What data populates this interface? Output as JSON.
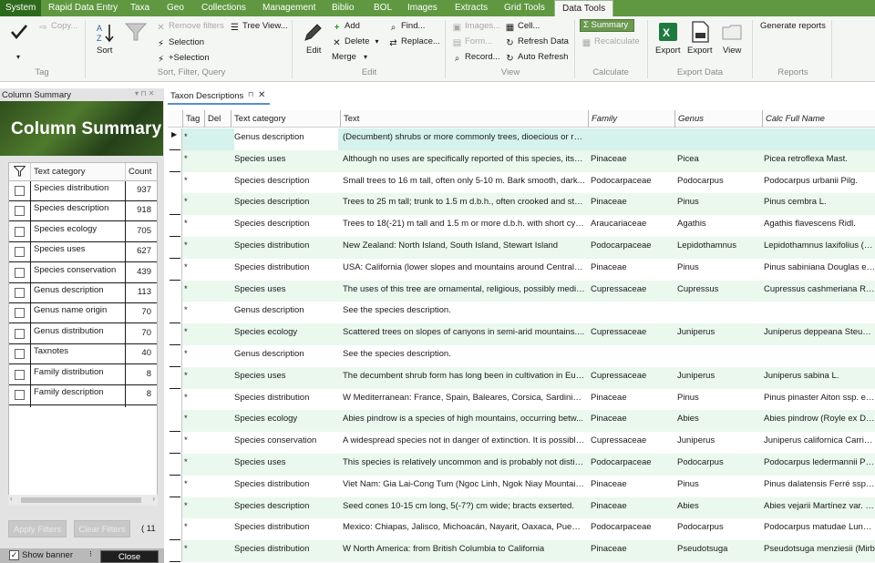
{
  "menu": {
    "system": "System",
    "tabs": [
      "Rapid Data Entry",
      "Taxa",
      "Geo",
      "Collections",
      "Management",
      "Biblio",
      "BOL",
      "Images",
      "Extracts",
      "Grid Tools"
    ],
    "active": "Data Tools"
  },
  "ribbon": {
    "tag_group": {
      "copy": "Copy...",
      "label": "Tag"
    },
    "sort_group": {
      "sort": "Sort",
      "remove_filters": "Remove filters",
      "tree_view": "Tree View...",
      "selection": "Selection",
      "plus_selection": "+Selection",
      "label": "Sort, Filter, Query"
    },
    "edit_group": {
      "edit": "Edit",
      "add": "Add",
      "delete": "Delete",
      "merge": "Merge",
      "find": "Find...",
      "replace": "Replace...",
      "label": "Edit"
    },
    "view_group": {
      "images": "Images...",
      "form": "Form...",
      "record": "Record...",
      "cell": "Cell...",
      "refresh_data": "Refresh Data",
      "auto_refresh": "Auto Refresh",
      "label": "View"
    },
    "calc_group": {
      "summary": "Summary",
      "recalculate": "Recalculate",
      "label": "Calculate"
    },
    "export_group": {
      "export": "Export",
      "export2": "Export",
      "view": "View",
      "label": "Export Data"
    },
    "reports_group": {
      "generate": "Generate reports",
      "label": "Reports"
    }
  },
  "column_summary": {
    "panel_title": "Column Summary",
    "banner": "Column Summary",
    "col_category": "Text category",
    "col_count": "Count",
    "rows": [
      {
        "cat": "Species distribution",
        "count": "937"
      },
      {
        "cat": "Species description",
        "count": "918"
      },
      {
        "cat": "Species ecology",
        "count": "705"
      },
      {
        "cat": "Species uses",
        "count": "627"
      },
      {
        "cat": "Species conservation",
        "count": "439"
      },
      {
        "cat": "Genus description",
        "count": "113"
      },
      {
        "cat": "Genus name origin",
        "count": "70"
      },
      {
        "cat": "Genus distribution",
        "count": "70"
      },
      {
        "cat": "Taxnotes",
        "count": "40"
      },
      {
        "cat": "Family distribution",
        "count": "8"
      },
      {
        "cat": "Family description",
        "count": "8"
      }
    ],
    "apply_filters": "Apply Filters",
    "clear_filters": "Clear Filters",
    "count_label": "( 11",
    "show_banner": "Show banner",
    "close": "Close"
  },
  "doc_tab": {
    "title": "Taxon Descriptions"
  },
  "grid": {
    "columns": [
      "Tag",
      "Del",
      "Text category",
      "Text",
      "Family",
      "Genus",
      "Calc Full Name"
    ],
    "rows": [
      {
        "tag": "*",
        "cat": "Genus description",
        "text": "(Decumbent) shrubs or more commonly trees, dioecious or ra...",
        "family": "",
        "genus": "",
        "name": ""
      },
      {
        "tag": "*",
        "cat": "Species uses",
        "text": "Although no uses are specifically reported of this species, its ti...",
        "family": "Pinaceae",
        "genus": "Picea",
        "name": "Picea retroflexa Mast."
      },
      {
        "tag": "*",
        "cat": "Species description",
        "text": "Small trees to 16 m tall, often only 5-10 m. Bark smooth, dark...",
        "family": "Podocarpaceae",
        "genus": "Podocarpus",
        "name": "Podocarpus urbanii Pilg."
      },
      {
        "tag": "*",
        "cat": "Species description",
        "text": "Trees to 25 m tall; trunk to 1.5 m d.b.h., often crooked and stu...",
        "family": "Pinaceae",
        "genus": "Pinus",
        "name": "Pinus cembra L."
      },
      {
        "tag": "*",
        "cat": "Species description",
        "text": "Trees to 18(-21) m tall and 1.5 m or more d.b.h. with short cyli...",
        "family": "Araucariaceae",
        "genus": "Agathis",
        "name": "Agathis flavescens Ridl."
      },
      {
        "tag": "*",
        "cat": "Species distribution",
        "text": "New Zealand: North Island, South Island, Stewart Island",
        "family": "Podocarpaceae",
        "genus": "Lepidothamnus",
        "name": "Lepidothamnus laxifolius (Hook"
      },
      {
        "tag": "*",
        "cat": "Species distribution",
        "text": "USA: California (lower slopes and mountains around Central V...",
        "family": "Pinaceae",
        "genus": "Pinus",
        "name": "Pinus sabiniana Douglas ex D"
      },
      {
        "tag": "*",
        "cat": "Species uses",
        "text": "The uses of this tree are ornamental, religious, possibly medici...",
        "family": "Cupressaceae",
        "genus": "Cupressus",
        "name": "Cupressus cashmeriana Royle"
      },
      {
        "tag": "*",
        "cat": "Genus description",
        "text": "See the species description.",
        "family": "",
        "genus": "",
        "name": ""
      },
      {
        "tag": "*",
        "cat": "Species ecology",
        "text": "Scattered trees on slopes of canyons in semi-arid mountains....",
        "family": "Cupressaceae",
        "genus": "Juniperus",
        "name": "Juniperus deppeana Steud. va"
      },
      {
        "tag": "*",
        "cat": "Genus description",
        "text": "See the species description.",
        "family": "",
        "genus": "",
        "name": ""
      },
      {
        "tag": "*",
        "cat": "Species uses",
        "text": "The decumbent shrub form has long been in cultivation in Eur...",
        "family": "Cupressaceae",
        "genus": "Juniperus",
        "name": "Juniperus sabina L."
      },
      {
        "tag": "*",
        "cat": "Species distribution",
        "text": "W Mediterranean: France, Spain, Baleares, Corsica, Sardinia, It...",
        "family": "Pinaceae",
        "genus": "Pinus",
        "name": "Pinus pinaster Aiton ssp. esca"
      },
      {
        "tag": "*",
        "cat": "Species ecology",
        "text": "Abies pindrow is a species of high mountains, occurring betw...",
        "family": "Pinaceae",
        "genus": "Abies",
        "name": "Abies pindrow (Royle ex D. D"
      },
      {
        "tag": "*",
        "cat": "Species conservation",
        "text": "A widespread species not in danger of extinction. It is possibly...",
        "family": "Cupressaceae",
        "genus": "Juniperus",
        "name": "Juniperus californica Carrière"
      },
      {
        "tag": "*",
        "cat": "Species uses",
        "text": "This species is relatively uncommon and is probably not distin...",
        "family": "Podocarpaceae",
        "genus": "Podocarpus",
        "name": "Podocarpus ledermannii Pilg."
      },
      {
        "tag": "*",
        "cat": "Species distribution",
        "text": "Viet Nam: Gia Lai-Cong Tum (Ngoc Linh, Ngok Niay Mountain...",
        "family": "Pinaceae",
        "genus": "Pinus",
        "name": "Pinus dalatensis Ferré ssp. pr"
      },
      {
        "tag": "*",
        "cat": "Species description",
        "text": "Seed cones 10-15 cm long, 5(-7?) cm wide; bracts exserted.",
        "family": "Pinaceae",
        "genus": "Abies",
        "name": "Abies vejarii Martínez var. ma"
      },
      {
        "tag": "*",
        "cat": "Species distribution",
        "text": "Mexico: Chiapas, Jalisco, Michoacán, Nayarit, Oaxaca, Puebla,...",
        "family": "Podocarpaceae",
        "genus": "Podocarpus",
        "name": "Podocarpus matudae Lundell"
      },
      {
        "tag": "*",
        "cat": "Species distribution",
        "text": "W North America: from British Columbia to California",
        "family": "Pinaceae",
        "genus": "Pseudotsuga",
        "name": "Pseudotsuga menziesii (Mirb"
      }
    ]
  },
  "colors": {
    "menu_green": "#5f9840",
    "system_green": "#2e6a1c",
    "row_stripe": "#eaf8ee",
    "row_selected": "#d6f2ec",
    "summary_button": "#6a9950"
  }
}
